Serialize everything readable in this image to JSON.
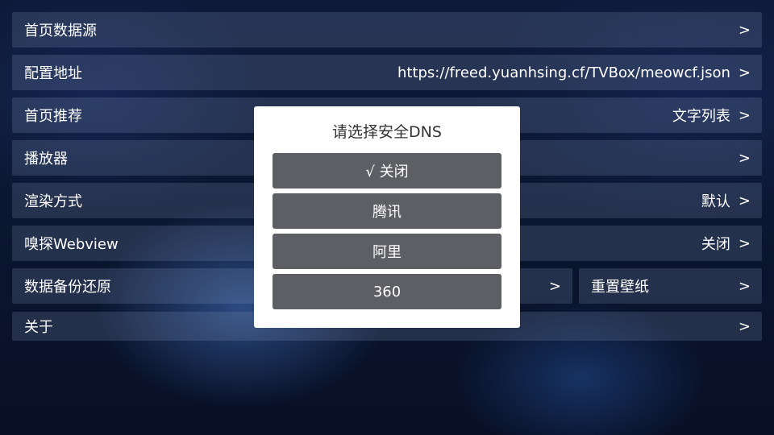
{
  "settings": {
    "home_source": {
      "label": "首页数据源",
      "chevron": ">"
    },
    "config_url": {
      "label": "配置地址",
      "value": "https://freed.yuanhsing.cf/TVBox/meowcf.json",
      "chevron": ">"
    },
    "home_recommend": {
      "label": "首页推荐",
      "value": "文字列表",
      "chevron": ">"
    },
    "player": {
      "label": "播放器",
      "chevron": ">"
    },
    "render_mode": {
      "label": "渲染方式",
      "value": "默认",
      "chevron": ">"
    },
    "sniff_webview": {
      "label": "嗅探Webview",
      "value": "关闭",
      "chevron": ">"
    },
    "backup_restore": {
      "label": "数据备份还原",
      "chevron": ">"
    },
    "reset_wallpaper": {
      "label": "重置壁纸",
      "chevron": ">"
    },
    "about": {
      "label": "关于",
      "chevron": ">"
    }
  },
  "dialog": {
    "title": "请选择安全DNS",
    "options": [
      {
        "label": "√ 关闭",
        "selected": true
      },
      {
        "label": "腾讯",
        "selected": false
      },
      {
        "label": "阿里",
        "selected": false
      },
      {
        "label": "360",
        "selected": false
      }
    ]
  },
  "colors": {
    "row_bg": "#2e3c5a",
    "option_bg": "#5e5f65",
    "dialog_bg": "#ffffff"
  }
}
